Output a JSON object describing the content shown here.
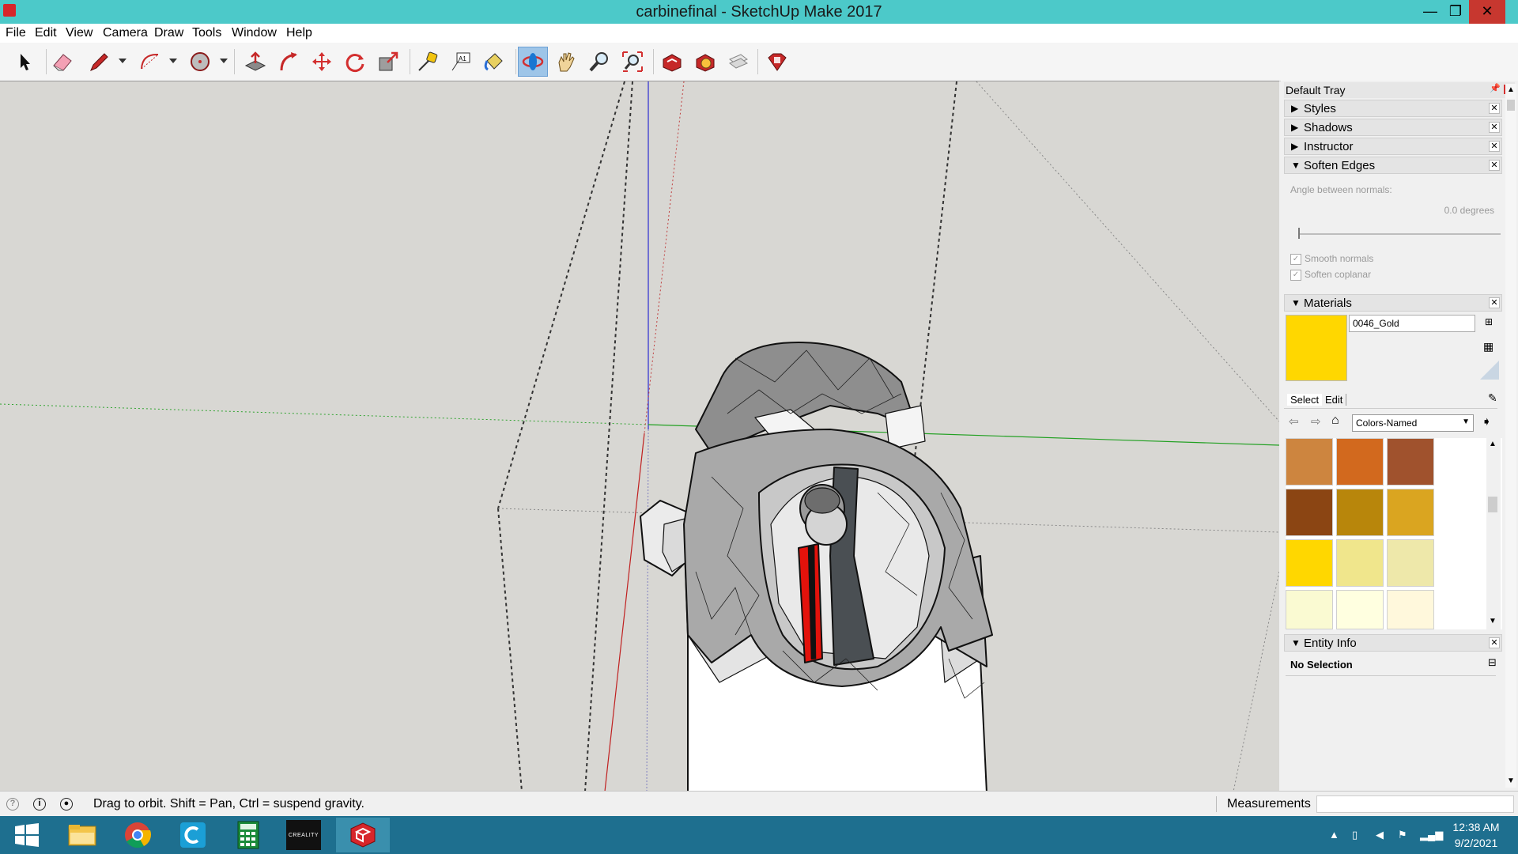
{
  "window": {
    "title": "carbinefinal - SketchUp Make 2017",
    "minimize_glyph": "—",
    "maximize_glyph": "❐",
    "close_glyph": "✕"
  },
  "menu": [
    "File",
    "Edit",
    "View",
    "Camera",
    "Draw",
    "Tools",
    "Window",
    "Help"
  ],
  "toolbar": {
    "tools": [
      "select-icon",
      "eraser-icon",
      "pencil-line-icon",
      "arc-icon",
      "circle-shape-icon",
      "push-pull-icon",
      "follow-me-icon",
      "move-icon",
      "rotate-icon",
      "scale-icon",
      "tape-measure-icon",
      "text-icon",
      "paint-bucket-icon",
      "orbit-icon",
      "pan-icon",
      "zoom-icon",
      "zoom-extents-icon",
      "3d-warehouse-icon",
      "extension-warehouse-icon",
      "layout-icon",
      "extension-manager-icon"
    ],
    "active_tool": "orbit-icon",
    "text_tool_glyph": "A1"
  },
  "tray": {
    "title": "Default Tray",
    "panels": {
      "styles": "Styles",
      "shadows": "Shadows",
      "instructor": "Instructor",
      "soften_edges": "Soften Edges",
      "materials": "Materials",
      "entity_info": "Entity Info"
    },
    "soften": {
      "angle_label": "Angle between normals:",
      "angle_value": "0.0  degrees",
      "smooth_normals": "Smooth normals",
      "soften_coplanar": "Soften coplanar",
      "smooth_checked": true,
      "coplanar_checked": true
    },
    "materials": {
      "current_name": "0046_Gold",
      "current_color": "#ffd700",
      "tab_select": "Select",
      "tab_edit": "Edit",
      "library": "Colors-Named",
      "swatches": [
        "#cd853f",
        "#d2691e",
        "#a0522d",
        "#8b4513",
        "#b8860b",
        "#daa520",
        "#ffd700",
        "#f0e68c",
        "#eee8aa",
        "#fafad2",
        "#ffffe0",
        "#fff8dc"
      ]
    },
    "entity_info": {
      "selection": "No Selection"
    }
  },
  "status": {
    "hint": "Drag to orbit. Shift = Pan, Ctrl = suspend gravity.",
    "measurements_label": "Measurements",
    "measurements_value": ""
  },
  "taskbar": {
    "apps": [
      "windows-start-icon",
      "file-explorer-icon",
      "chrome-icon",
      "ccleaner-icon",
      "calculator-icon",
      "creality-icon",
      "sketchup-icon"
    ],
    "creality_label": "CREALITY",
    "time": "12:38 AM",
    "date": "9/2/2021"
  }
}
